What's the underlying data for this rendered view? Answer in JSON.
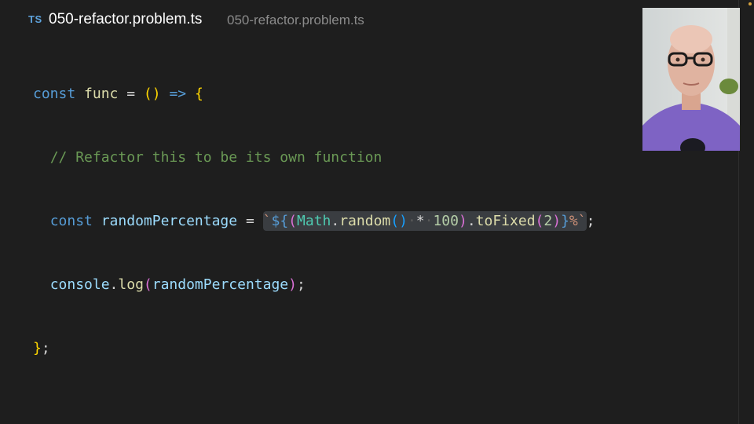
{
  "tab": {
    "language_badge": "TS",
    "file_name": "050-refactor.problem.ts",
    "file_path": "050-refactor.problem.ts"
  },
  "code": {
    "line1": {
      "const": "const",
      "name": "func",
      "eq": "=",
      "parens": "()",
      "arrow": "=>",
      "brace": "{"
    },
    "line2": {
      "comment": "// Refactor this to be its own function"
    },
    "line3": {
      "const": "const",
      "name": "randomPercentage",
      "eq": "=",
      "tick_open": "`",
      "interp_open": "${",
      "paren_open": "(",
      "math": "Math",
      "dot1": ".",
      "random": "random",
      "call_parens": "()",
      "ws1": "·",
      "mult": "*",
      "ws2": "·",
      "num100": "100",
      "paren_close": ")",
      "dot2": ".",
      "tofixed": "toFixed",
      "arg_open": "(",
      "num2": "2",
      "arg_close": ")",
      "interp_close": "}",
      "percent": "%",
      "tick_close": "`",
      "semi": ";"
    },
    "line4": {
      "console": "console",
      "dot": ".",
      "log": "log",
      "paren_open": "(",
      "arg": "randomPercentage",
      "paren_close": ")",
      "semi": ";"
    },
    "line5": {
      "close": "}",
      "semi": ";"
    }
  },
  "colors": {
    "background": "#1e1e1e",
    "keyword": "#569cd6",
    "function": "#dcdcaa",
    "variable": "#9cdcfe",
    "comment": "#6a9955",
    "string": "#ce9178",
    "number": "#b5cea8"
  },
  "webcam": {
    "shirt_color": "#7e63c4"
  }
}
